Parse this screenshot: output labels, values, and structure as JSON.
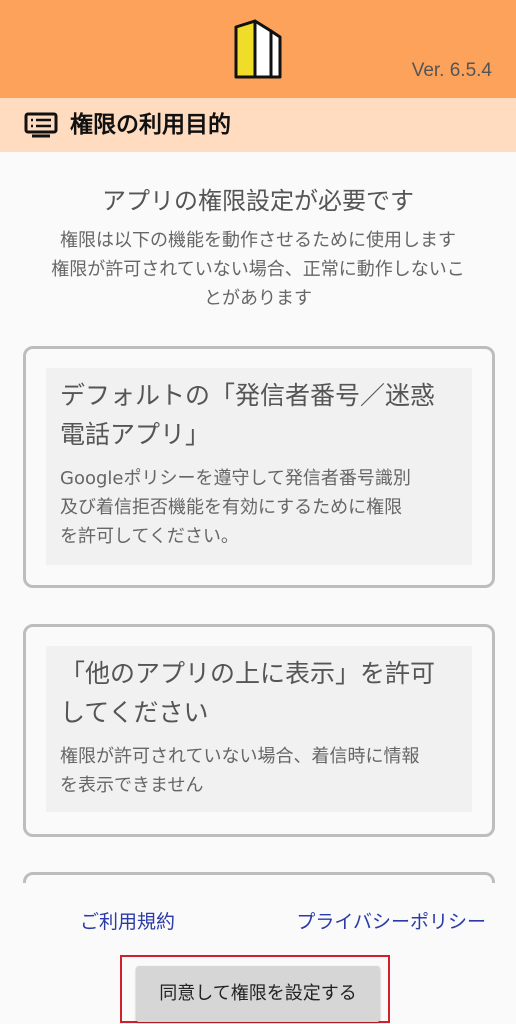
{
  "header": {
    "version": "Ver. 6.5.4",
    "background_color": "#fda25a",
    "logo_icon": "building-logo-icon"
  },
  "section": {
    "icon": "message-list-icon",
    "title": "権限の利用目的",
    "background_color": "#ffdcc0"
  },
  "main": {
    "heading": "アプリの権限設定が必要です",
    "intro_lines": [
      "権限は以下の機能を動作させるために使用します",
      "権限が許可されていない場合、正常に動作しないこ",
      "とがあります"
    ]
  },
  "cards": [
    {
      "title_lines": [
        "デフォルトの「発信者番号／迷惑",
        "電話アプリ」"
      ],
      "desc_lines": [
        "Googleポリシーを遵守して発信者番号識別",
        "及び着信拒否機能を有効にするために権限",
        "を許可してください。"
      ]
    },
    {
      "title_lines": [
        "「他のアプリの上に表示」を許可",
        "してください"
      ],
      "desc_lines": [
        "権限が許可されていない場合、着信時に情報",
        "を表示できません"
      ]
    }
  ],
  "footer": {
    "terms_link": "ご利用規約",
    "privacy_link": "プライバシーポリシー",
    "agree_button": "同意して権限を設定する",
    "link_color": "#2a3aa8",
    "highlight_color": "#d0202c"
  }
}
